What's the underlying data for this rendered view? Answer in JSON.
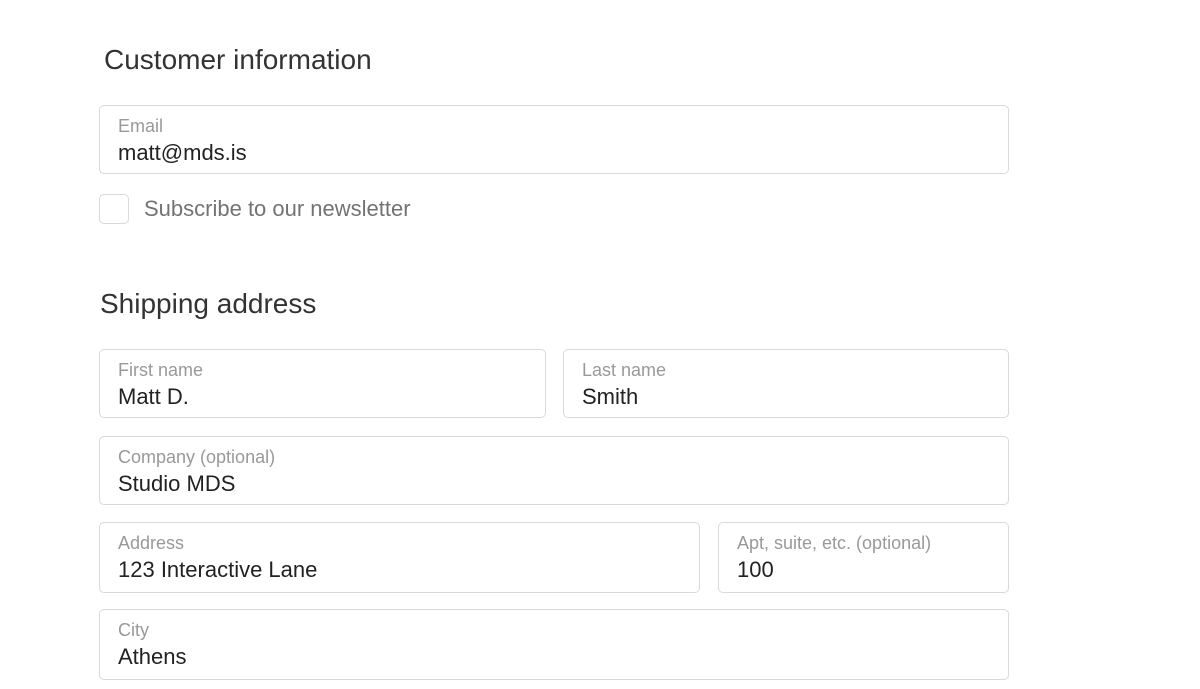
{
  "customer_info": {
    "title": "Customer information",
    "email": {
      "label": "Email",
      "value": "matt@mds.is"
    },
    "newsletter": {
      "label": "Subscribe to our newsletter",
      "checked": false
    }
  },
  "shipping": {
    "title": "Shipping address",
    "first_name": {
      "label": "First name",
      "value": "Matt D."
    },
    "last_name": {
      "label": "Last name",
      "value": "Smith"
    },
    "company": {
      "label": "Company (optional)",
      "value": "Studio MDS"
    },
    "address": {
      "label": "Address",
      "value": "123 Interactive Lane"
    },
    "apt": {
      "label": "Apt, suite, etc. (optional)",
      "value": "100"
    },
    "city": {
      "label": "City",
      "value": "Athens"
    }
  }
}
